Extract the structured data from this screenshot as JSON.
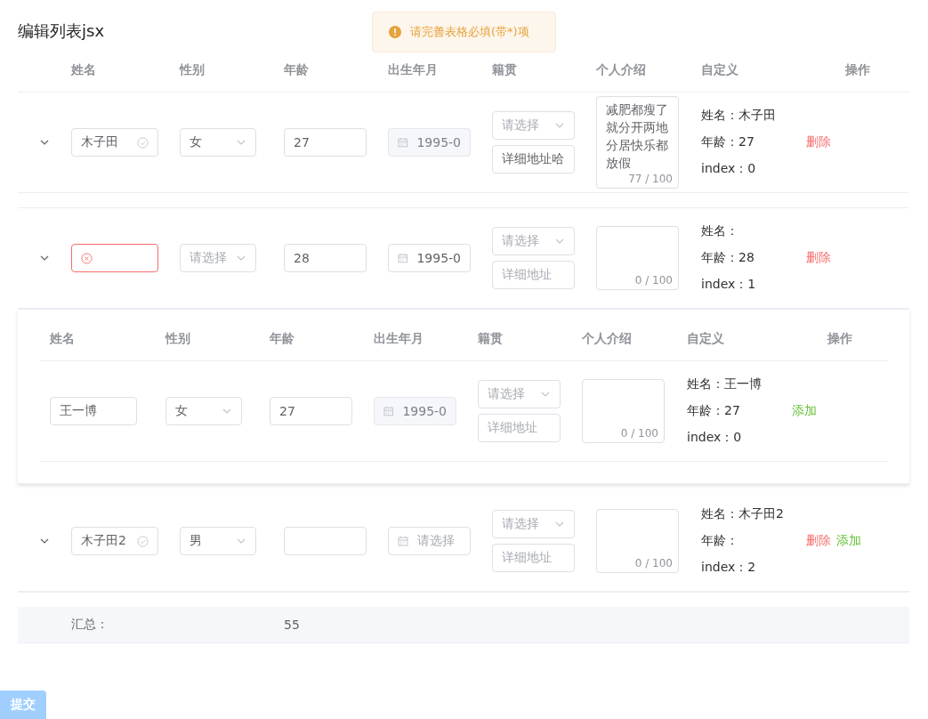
{
  "title": "编辑列表jsx",
  "alert": {
    "kind": "warning",
    "text": "请完善表格必填(带*)项"
  },
  "table": {
    "columns": [
      "姓名",
      "性别",
      "年龄",
      "出生年月",
      "籍贯",
      "个人介绍",
      "自定义",
      "操作"
    ],
    "rows": [
      {
        "name": {
          "value": "木子田",
          "kind": "valid"
        },
        "gender": {
          "value": "女"
        },
        "age": "27",
        "birth": {
          "value": "1995-0",
          "disabled": true
        },
        "native": {
          "placeholder": "请选择"
        },
        "address": {
          "value": "详细地址哈"
        },
        "intro": {
          "value": "减肥都瘦了就分开两地分居快乐都放假",
          "count": "77 / 100"
        },
        "custom": [
          "姓名：木子田",
          "年龄：27",
          "index：0"
        ],
        "actions": [
          {
            "kind": "delete",
            "label": "删除"
          }
        ]
      },
      {
        "name": {
          "kind": "error"
        },
        "gender": {
          "placeholder": "请选择"
        },
        "age": "28",
        "birth": {
          "value": "1995-0",
          "disabled": false
        },
        "native": {
          "placeholder": "请选择"
        },
        "address": {
          "placeholder": "详细地址"
        },
        "intro": {
          "count": "0 / 100"
        },
        "custom": [
          "姓名：",
          "年龄：28",
          "index：1"
        ],
        "actions": [
          {
            "kind": "delete",
            "label": "删除"
          }
        ],
        "expansion": {
          "columns": [
            "姓名",
            "性别",
            "年龄",
            "出生年月",
            "籍贯",
            "个人介绍",
            "自定义",
            "操作"
          ],
          "rows": [
            {
              "name": {
                "value": "王一博"
              },
              "gender": {
                "value": "女"
              },
              "age": "27",
              "birth": {
                "value": "1995-0",
                "disabled": true
              },
              "native": {
                "placeholder": "请选择"
              },
              "address": {
                "placeholder": "详细地址"
              },
              "intro": {
                "count": "0 / 100"
              },
              "custom": [
                "姓名：王一博",
                "年龄：27",
                "index：0"
              ],
              "actions": [
                {
                  "kind": "add",
                  "label": "添加"
                }
              ]
            }
          ]
        }
      },
      {
        "name": {
          "value": "木子田2",
          "kind": "valid"
        },
        "gender": {
          "value": "男"
        },
        "birth": {
          "placeholder": "请选择",
          "disabled": false
        },
        "native": {
          "placeholder": "请选择"
        },
        "address": {
          "placeholder": "详细地址"
        },
        "intro": {
          "count": "0 / 100"
        },
        "custom": [
          "姓名：木子田2",
          "年龄：",
          "index：2"
        ],
        "actions": [
          {
            "kind": "delete",
            "label": "删除"
          },
          {
            "kind": "add",
            "label": "添加"
          }
        ]
      }
    ],
    "summary": {
      "label": "汇总：",
      "age_total": "55"
    }
  },
  "submit": {
    "label": "提交",
    "disabled": true
  }
}
